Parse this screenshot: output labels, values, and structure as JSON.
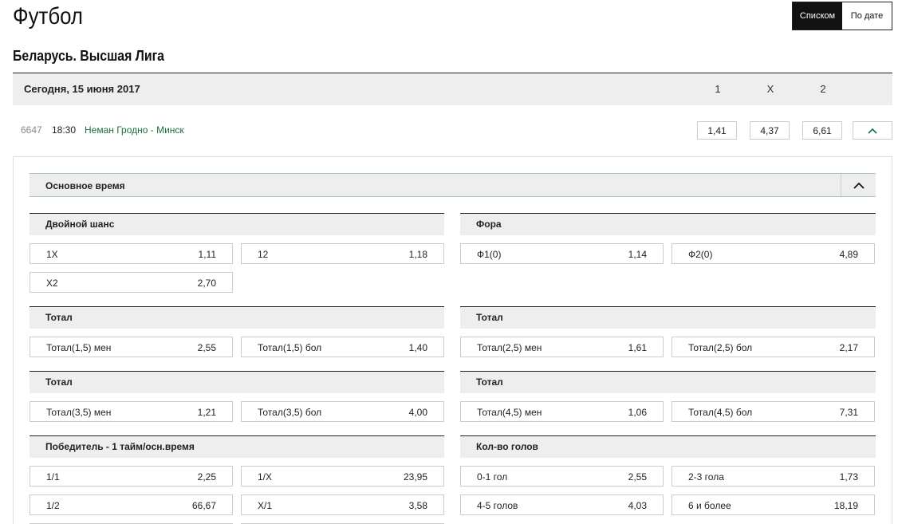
{
  "page": {
    "title": "Футбол"
  },
  "view_toggle": {
    "list_label": "Списком",
    "date_label": "По дате"
  },
  "league": {
    "title": "Беларусь. Высшая Лига"
  },
  "date_bar": {
    "date": "Сегодня, 15 июня 2017",
    "col1": "1",
    "colx": "X",
    "col2": "2"
  },
  "match": {
    "id": "6647",
    "time": "18:30",
    "teams": "Неман Гродно - Минск",
    "odds": [
      "1,41",
      "4,37",
      "6,61"
    ]
  },
  "section": {
    "label": "Основное время"
  },
  "markets": {
    "double_chance": {
      "title": "Двойной шанс",
      "bets": [
        {
          "name": "1X",
          "value": "1,11"
        },
        {
          "name": "12",
          "value": "1,18"
        },
        {
          "name": "X2",
          "value": "2,70"
        }
      ]
    },
    "handicap": {
      "title": "Фора",
      "bets": [
        {
          "name": "Ф1(0)",
          "value": "1,14"
        },
        {
          "name": "Ф2(0)",
          "value": "4,89"
        }
      ]
    },
    "total_a": {
      "title": "Тотал",
      "bets": [
        {
          "name": "Тотал(1,5) мен",
          "value": "2,55"
        },
        {
          "name": "Тотал(1,5) бол",
          "value": "1,40"
        }
      ]
    },
    "total_b": {
      "title": "Тотал",
      "bets": [
        {
          "name": "Тотал(2,5) мен",
          "value": "1,61"
        },
        {
          "name": "Тотал(2,5) бол",
          "value": "2,17"
        }
      ]
    },
    "total_c": {
      "title": "Тотал",
      "bets": [
        {
          "name": "Тотал(3,5) мен",
          "value": "1,21"
        },
        {
          "name": "Тотал(3,5) бол",
          "value": "4,00"
        }
      ]
    },
    "total_d": {
      "title": "Тотал",
      "bets": [
        {
          "name": "Тотал(4,5) мен",
          "value": "1,06"
        },
        {
          "name": "Тотал(4,5) бол",
          "value": "7,31"
        }
      ]
    },
    "half_full": {
      "title": "Победитель - 1 тайм/осн.время",
      "bets": [
        {
          "name": "1/1",
          "value": "2,25"
        },
        {
          "name": "1/X",
          "value": "23,95"
        },
        {
          "name": "1/2",
          "value": "66,67"
        },
        {
          "name": "X/1",
          "value": "3,58"
        }
      ]
    },
    "goals": {
      "title": "Кол-во голов",
      "bets": [
        {
          "name": "0-1 гол",
          "value": "2,55"
        },
        {
          "name": "2-3 гола",
          "value": "1,73"
        },
        {
          "name": "4-5 голов",
          "value": "4,03"
        },
        {
          "name": "6 и более",
          "value": "18,19"
        }
      ]
    }
  },
  "icons": {
    "collapse": "chevron-up-icon"
  },
  "colors": {
    "accent": "#1a6e3f",
    "dark": "#111111",
    "panel": "#eeeeee"
  }
}
